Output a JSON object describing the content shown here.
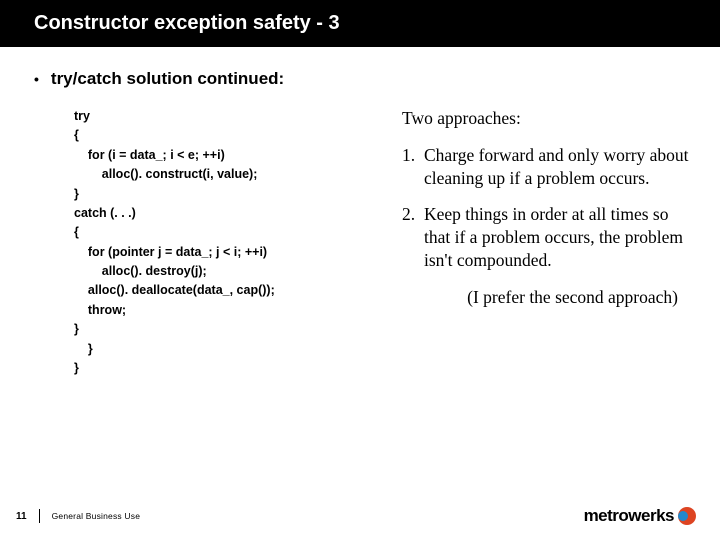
{
  "title": "Constructor exception safety - 3",
  "bullet": "try/catch solution continued:",
  "code": "try\n{\n    for (i = data_; i < e; ++i)\n        alloc(). construct(i, value);\n}\ncatch (. . .)\n{\n    for (pointer j = data_; j < i; ++i)\n        alloc(). destroy(j);\n    alloc(). deallocate(data_, cap());\n    throw;\n}\n    }\n}",
  "approaches_heading": "Two approaches:",
  "approaches": [
    {
      "num": "1.",
      "text": "Charge forward and only worry about cleaning up if a problem occurs."
    },
    {
      "num": "2.",
      "text": "Keep things in order at all times so that if a problem occurs, the problem isn't compounded."
    }
  ],
  "prefer": "(I prefer the second approach)",
  "footer": {
    "page": "11",
    "label": "General Business Use",
    "brand": "metrowerks"
  }
}
